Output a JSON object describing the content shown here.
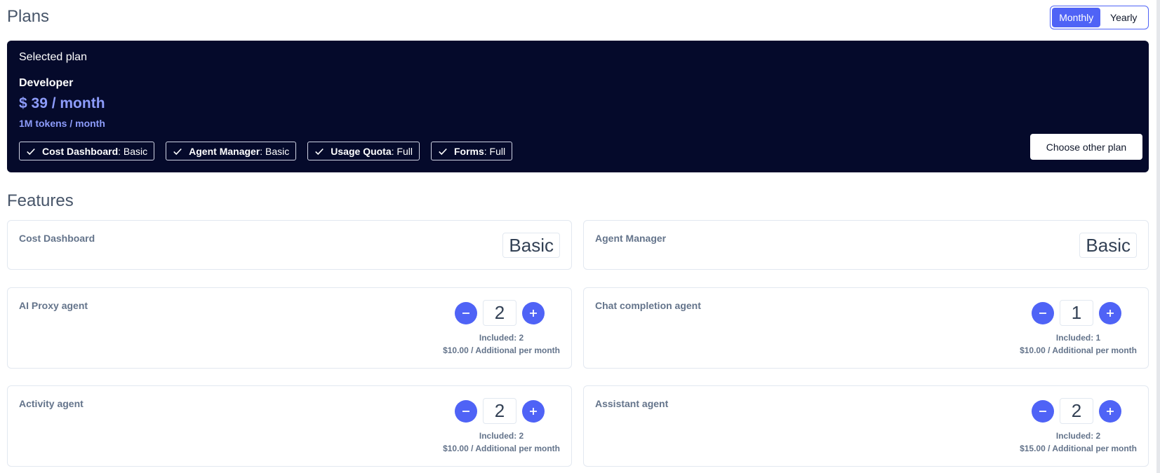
{
  "header": {
    "title": "Plans",
    "billing": {
      "monthly_label": "Monthly",
      "yearly_label": "Yearly",
      "selected": "Monthly"
    }
  },
  "selected_plan": {
    "label": "Selected plan",
    "name": "Developer",
    "price": "$ 39 / month",
    "tokens": "1M tokens / month",
    "features": [
      {
        "name": "Cost Dashboard",
        "level": ": Basic"
      },
      {
        "name": "Agent Manager",
        "level": ": Basic"
      },
      {
        "name": "Usage Quota",
        "level": ": Full"
      },
      {
        "name": "Forms",
        "level": ": Full"
      }
    ],
    "choose_other_label": "Choose other plan"
  },
  "features_section": {
    "title": "Features",
    "levels": [
      {
        "label": "Cost Dashboard",
        "value": "Basic"
      },
      {
        "label": "Agent Manager",
        "value": "Basic"
      }
    ],
    "agents": [
      {
        "label": "AI Proxy agent",
        "count": "2",
        "included": "Included: 2",
        "price": "$10.00 / Additional per month"
      },
      {
        "label": "Chat completion agent",
        "count": "1",
        "included": "Included: 1",
        "price": "$10.00 / Additional per month"
      },
      {
        "label": "Activity agent",
        "count": "2",
        "included": "Included: 2",
        "price": "$10.00 / Additional per month"
      },
      {
        "label": "Assistant agent",
        "count": "2",
        "included": "Included: 2",
        "price": "$15.00 / Additional per month"
      }
    ]
  },
  "colors": {
    "accent": "#4f63f6",
    "banner_bg": "#050a2b",
    "price_text": "#8d9cfb"
  }
}
